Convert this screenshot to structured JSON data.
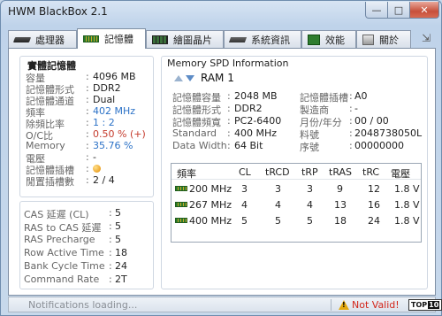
{
  "window": {
    "title": "HWM BlackBox 2.1",
    "min": "—",
    "max": "□",
    "close": "✕"
  },
  "tabs": [
    {
      "label": "處理器",
      "icon": "cpu-icon",
      "active": false
    },
    {
      "label": "記憶體",
      "icon": "memory-icon",
      "active": true
    },
    {
      "label": "繪圖晶片",
      "icon": "gpu-icon",
      "active": false
    },
    {
      "label": "系統資訊",
      "icon": "system-icon",
      "active": false
    },
    {
      "label": "效能",
      "icon": "performance-icon",
      "active": false
    },
    {
      "label": "關於",
      "icon": "about-icon",
      "active": false
    }
  ],
  "tab_extra": "⇲",
  "memory": {
    "title": "實體記憶體",
    "rows": [
      {
        "k": "容量",
        "v": "4096 MB",
        "color": "normal"
      },
      {
        "k": "記憶體形式",
        "v": "DDR2",
        "color": "normal"
      },
      {
        "k": "記憶體通道",
        "v": "Dual",
        "color": "normal"
      },
      {
        "k": "頻率",
        "v": "402 MHz",
        "color": "blue"
      },
      {
        "k": "除頻比率",
        "v": "1 : 2",
        "color": "blue"
      },
      {
        "k": "O/C比",
        "v": "0.50 % (+)",
        "color": "red"
      },
      {
        "k": "Memory",
        "v": "35.76 %",
        "color": "blue"
      },
      {
        "k": "電壓",
        "v": "-",
        "color": "normal"
      },
      {
        "k": "記憶體插槽",
        "v": "",
        "color": "normal"
      },
      {
        "k": "閒置插槽數",
        "v": "2  /  4",
        "color": "normal"
      }
    ]
  },
  "timings": [
    {
      "k": "CAS 延遲 (CL)",
      "v": "5"
    },
    {
      "k": "RAS to CAS 延遲",
      "v": "5"
    },
    {
      "k": "RAS Precharge",
      "v": "5"
    },
    {
      "k": "Row Active Time",
      "v": "18"
    },
    {
      "k": "Bank Cycle Time",
      "v": "24"
    },
    {
      "k": "Command Rate",
      "v": "2T"
    }
  ],
  "spd": {
    "title": "Memory SPD Information",
    "ram_label": "RAM  1",
    "left": [
      {
        "k": "記憶體容量",
        "v": "2048 MB"
      },
      {
        "k": "記憶體形式",
        "v": "DDR2"
      },
      {
        "k": "記憶體頻寬",
        "v": "PC2-6400"
      },
      {
        "k": "Standard",
        "v": "400 MHz"
      },
      {
        "k": "Data Width",
        "v": "64 Bit"
      }
    ],
    "right": [
      {
        "k": "記憶體插槽",
        "v": "A0"
      },
      {
        "k": "製造商",
        "v": "-"
      },
      {
        "k": "月份/年分",
        "v": "00 / 00"
      },
      {
        "k": "料號",
        "v": "2048738050L"
      },
      {
        "k": "序號",
        "v": "00000000"
      }
    ],
    "table": {
      "headers": [
        "頻率",
        "CL",
        "tRCD",
        "tRP",
        "tRAS",
        "tRC",
        "電壓"
      ],
      "rows": [
        [
          "200 MHz",
          "3",
          "3",
          "3",
          "9",
          "12",
          "1.8 V"
        ],
        [
          "267 MHz",
          "4",
          "4",
          "4",
          "13",
          "16",
          "1.8 V"
        ],
        [
          "400 MHz",
          "5",
          "5",
          "5",
          "18",
          "24",
          "1.8 V"
        ]
      ]
    }
  },
  "status": {
    "message": "Notifications loading...",
    "warning": "Not Valid!",
    "logo_top": "TOP",
    "logo_ten": "10"
  }
}
